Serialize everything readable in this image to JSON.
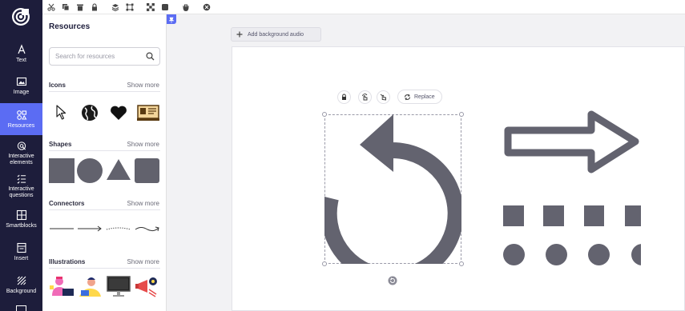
{
  "toolbar": {
    "icons": [
      "scissors-icon",
      "copy-icon",
      "trash-icon",
      "lock-icon",
      "layers-icon",
      "crop-icon",
      "checker-icon",
      "square-icon",
      "hand-icon",
      "badge-icon"
    ]
  },
  "nav": {
    "items": [
      {
        "label": "Text"
      },
      {
        "label": "Image"
      },
      {
        "label": "Resources"
      },
      {
        "label": "Interactive elements"
      },
      {
        "label": "Interactive questions"
      },
      {
        "label": "Smartblocks"
      },
      {
        "label": "Insert"
      },
      {
        "label": "Background"
      }
    ]
  },
  "panel": {
    "title": "Resources",
    "search_placeholder": "Search for resources",
    "sections": [
      {
        "title": "Icons",
        "more": "Show more"
      },
      {
        "title": "Shapes",
        "more": "Show more"
      },
      {
        "title": "Connectors",
        "more": "Show more"
      },
      {
        "title": "Illustrations",
        "more": "Show more"
      }
    ]
  },
  "canvas": {
    "audio_button": "Add background audio",
    "replace_button": "Replace"
  },
  "colors": {
    "accent": "#5b6cf3",
    "nav_bg": "#1d1d3b",
    "shape": "#5f5f6b"
  }
}
